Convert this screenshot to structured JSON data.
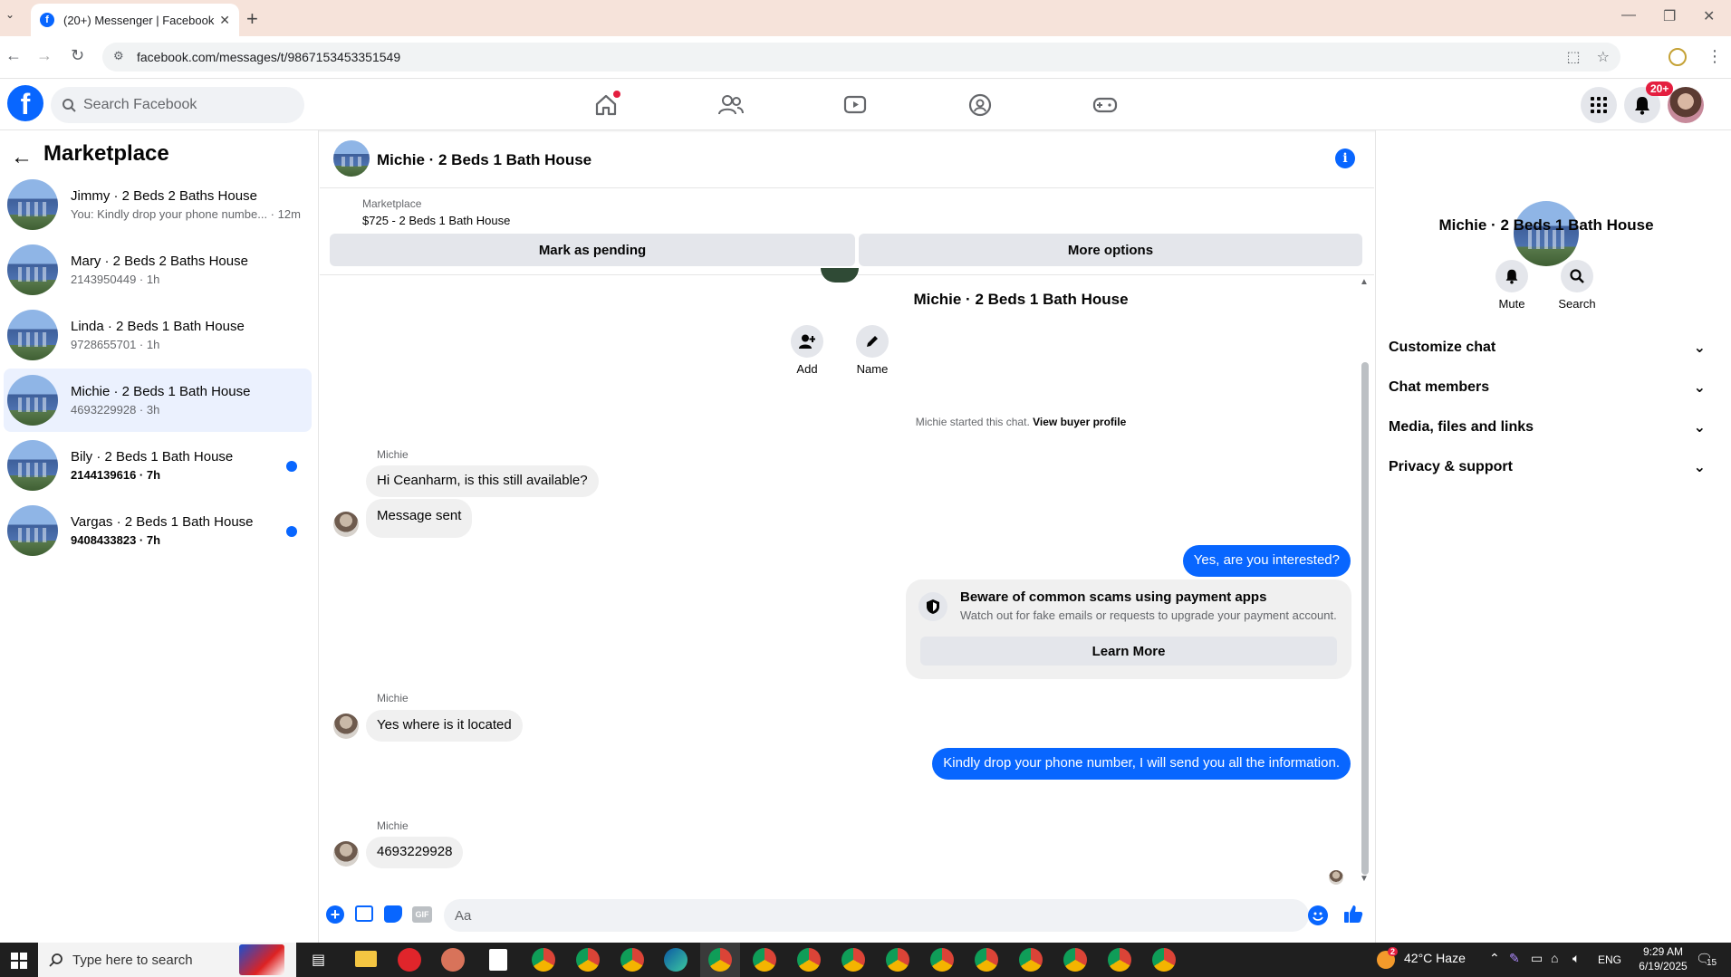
{
  "browser": {
    "tab_title": "(20+) Messenger | Facebook",
    "tab_close": "✕",
    "new_tab": "+",
    "url": "facebook.com/messages/t/9867153453351549",
    "minimize": "—",
    "restore": "❐",
    "close": "✕"
  },
  "fb": {
    "logo": "f",
    "search_placeholder": "Search Facebook",
    "notifications_badge": "20+"
  },
  "sidebar": {
    "title": "Marketplace",
    "back": "←",
    "conversations": [
      {
        "name": "Jimmy · 2 Beds 2 Baths House",
        "preview": "You: Kindly drop your phone numbe... · 12m",
        "unread": false,
        "active": false
      },
      {
        "name": "Mary · 2 Beds 2 Baths House",
        "preview": "2143950449 · 1h",
        "unread": false,
        "active": false
      },
      {
        "name": "Linda · 2 Beds 1 Bath House",
        "preview": "9728655701 · 1h",
        "unread": false,
        "active": false
      },
      {
        "name": "Michie · 2 Beds 1 Bath House",
        "preview": "4693229928 · 3h",
        "unread": false,
        "active": true
      },
      {
        "name": "Bily · 2 Beds 1 Bath House",
        "preview": "2144139616 · 7h",
        "unread": true,
        "active": false
      },
      {
        "name": "Vargas · 2 Beds 1 Bath House",
        "preview": "9408433823 · 7h",
        "unread": true,
        "active": false
      }
    ]
  },
  "chat": {
    "title": "Michie · 2 Beds 1 Bath House",
    "marketplace_label": "Marketplace",
    "listing": "$725 - 2 Beds 1 Bath House",
    "mark_pending": "Mark as pending",
    "more_options": "More options",
    "intro_name": "Michie · 2 Beds 1 Bath House",
    "add_label": "Add",
    "name_label": "Name",
    "started_text": "Michie started this chat.",
    "view_profile": "View buyer profile",
    "sender": "Michie",
    "messages": {
      "m1": "Hi Ceanharm, is this still available?",
      "m2": "Message sent",
      "m3": "Yes, are you interested?",
      "m4": "Yes where is it located",
      "m5": "Kindly drop your phone number, I will send you all the information.",
      "m6": "4693229928"
    },
    "scam": {
      "title": "Beware of common scams using payment apps",
      "body": "Watch out for fake emails or requests to upgrade your payment account.",
      "button": "Learn More"
    },
    "composer_placeholder": "Aa",
    "gif_label": "GIF"
  },
  "right_panel": {
    "name": "Michie · 2 Beds 1 Bath House",
    "mute": "Mute",
    "search": "Search",
    "sections": [
      "Customize chat",
      "Chat members",
      "Media, files and links",
      "Privacy & support"
    ]
  },
  "taskbar": {
    "search_placeholder": "Type here to search",
    "weather": "42°C  Haze",
    "weather_badge": "2",
    "lang": "ENG",
    "time": "9:29 AM",
    "date": "6/19/2025",
    "notif_count": "15"
  },
  "colors": {
    "brand": "#0866ff",
    "bubble_in": "#f0f0f0",
    "badge": "#e41e3f"
  }
}
